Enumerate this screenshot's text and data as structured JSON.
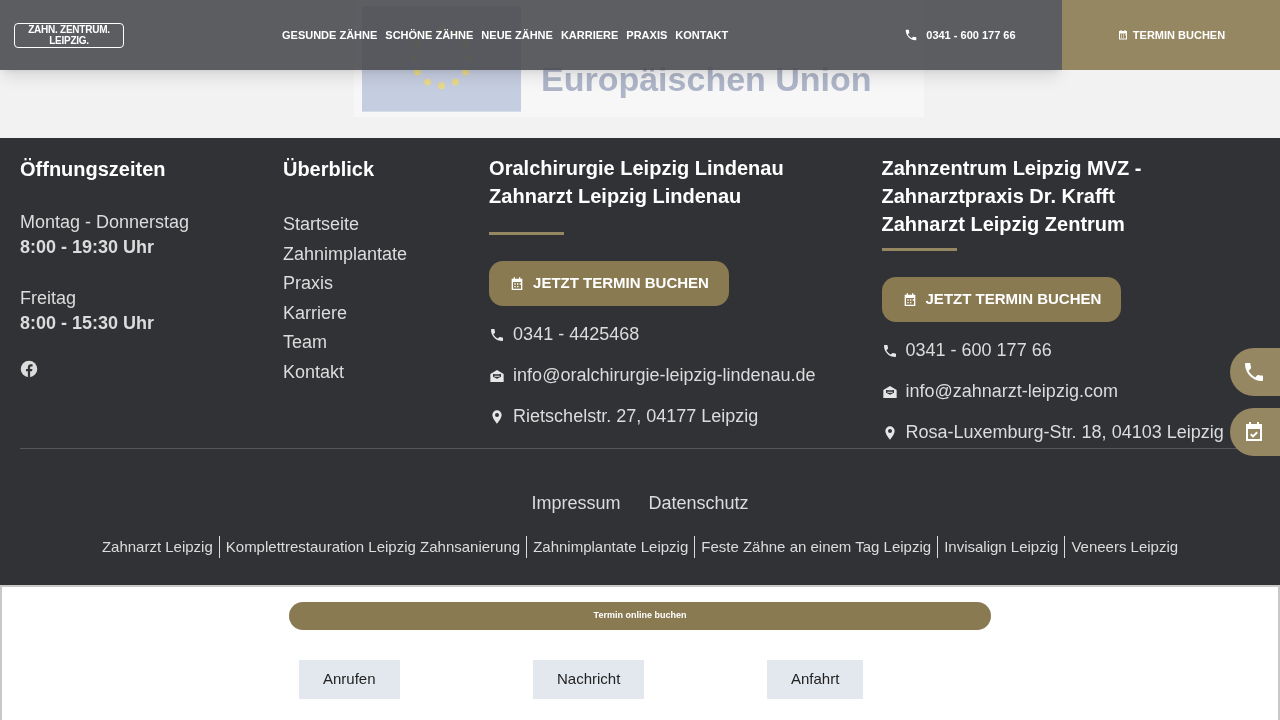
{
  "header": {
    "logo": [
      "ZAHN. ZENTRUM.",
      "LEIPZIG."
    ],
    "nav": [
      "GESUNDE ZÄHNE",
      "SCHÖNE ZÄHNE",
      "NEUE ZÄHNE",
      "KARRIERE",
      "PRAXIS",
      "KONTAKT"
    ],
    "phone": "0341 - 600 177 66",
    "cta": "TERMIN BUCHEN"
  },
  "banner": {
    "lines": [
      "Europäischen Union"
    ]
  },
  "footer": {
    "hours": {
      "title": "Öffnungszeiten",
      "entries": [
        {
          "days": "Montag - Donnerstag",
          "time": "8:00 - 19:30 Uhr"
        },
        {
          "days": "Freitag",
          "time": "8:00 - 15:30 Uhr"
        }
      ]
    },
    "overview": {
      "title": "Überblick",
      "links": [
        "Startseite",
        "Zahnimplantate",
        "Praxis",
        "Karriere",
        "Team",
        "Kontakt"
      ]
    },
    "locations": [
      {
        "title": "Oralchirurgie Leipzig Lindenau Zahnarzt Leipzig Lindenau",
        "button": "JETZT TERMIN BUCHEN",
        "phone": "0341 - 4425468",
        "email": "info@oralchirurgie-leipzig-lindenau.de",
        "address": "Rietschelstr. 27, 04177 Leipzig"
      },
      {
        "title": "Zahnzentrum Leipzig MVZ - Zahnarztpraxis Dr. Krafft Zahnarzt Leipzig Zentrum",
        "button": "JETZT TERMIN BUCHEN",
        "phone": "0341 - 600 177 66",
        "email": "info@zahnarzt-leipzig.com",
        "address": "Rosa-Luxemburg-Str. 18, 04103 Leipzig"
      }
    ],
    "legal": [
      "Impressum",
      "Datenschutz"
    ],
    "seo_links": [
      "Zahnarzt Leipzig",
      "Komplettrestauration Leipzig Zahnsanierung",
      "Zahnimplantate Leipzig",
      "Feste Zähne an einem Tag Leipzig",
      "Invisalign Leipzig",
      "Veneers Leipzig"
    ]
  },
  "bottom_bar": {
    "booking": "Termin online buchen",
    "buttons": [
      "Anrufen",
      "Nachricht",
      "Anfahrt"
    ]
  }
}
